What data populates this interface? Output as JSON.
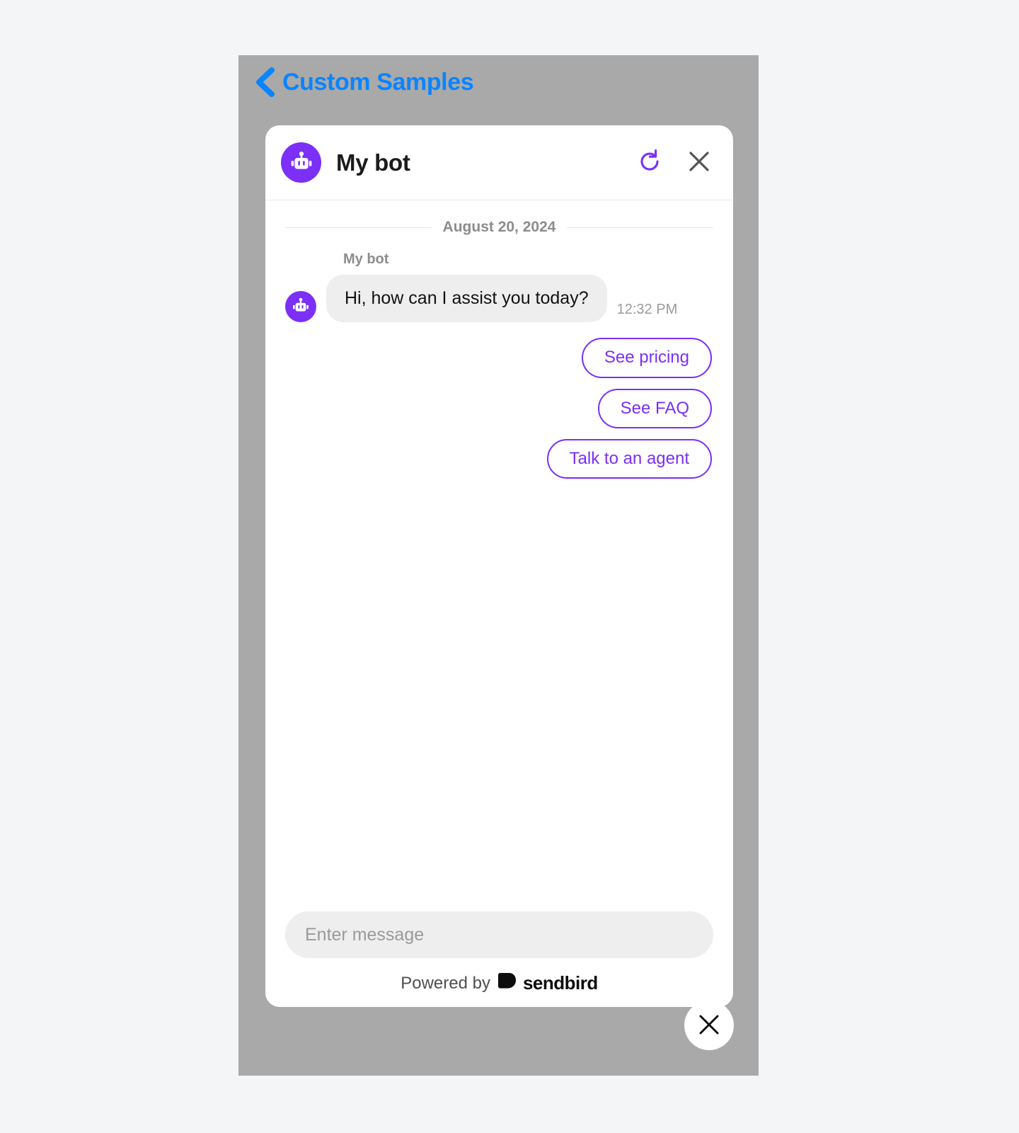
{
  "nav": {
    "back_icon": "chevron-left-icon",
    "title": "Custom Samples",
    "accent_color": "#0a84ff"
  },
  "widget": {
    "header": {
      "avatar_icon": "robot-icon",
      "title": "My bot",
      "refresh_icon": "refresh-icon",
      "close_icon": "close-icon",
      "accent_color": "#7b2ff7"
    },
    "conversation": {
      "date_label": "August 20, 2024",
      "messages": [
        {
          "sender": "My bot",
          "avatar_icon": "robot-icon",
          "text": "Hi, how can I assist you today?",
          "time": "12:32 PM"
        }
      ],
      "quick_replies": [
        {
          "label": "See pricing"
        },
        {
          "label": "See FAQ"
        },
        {
          "label": "Talk to an agent"
        }
      ]
    },
    "input": {
      "value": "",
      "placeholder": "Enter message"
    },
    "footer": {
      "powered_by_text": "Powered by",
      "brand_name": "sendbird",
      "brand_mark_icon": "sendbird-logo-icon"
    }
  },
  "launcher": {
    "close_icon": "close-icon"
  }
}
